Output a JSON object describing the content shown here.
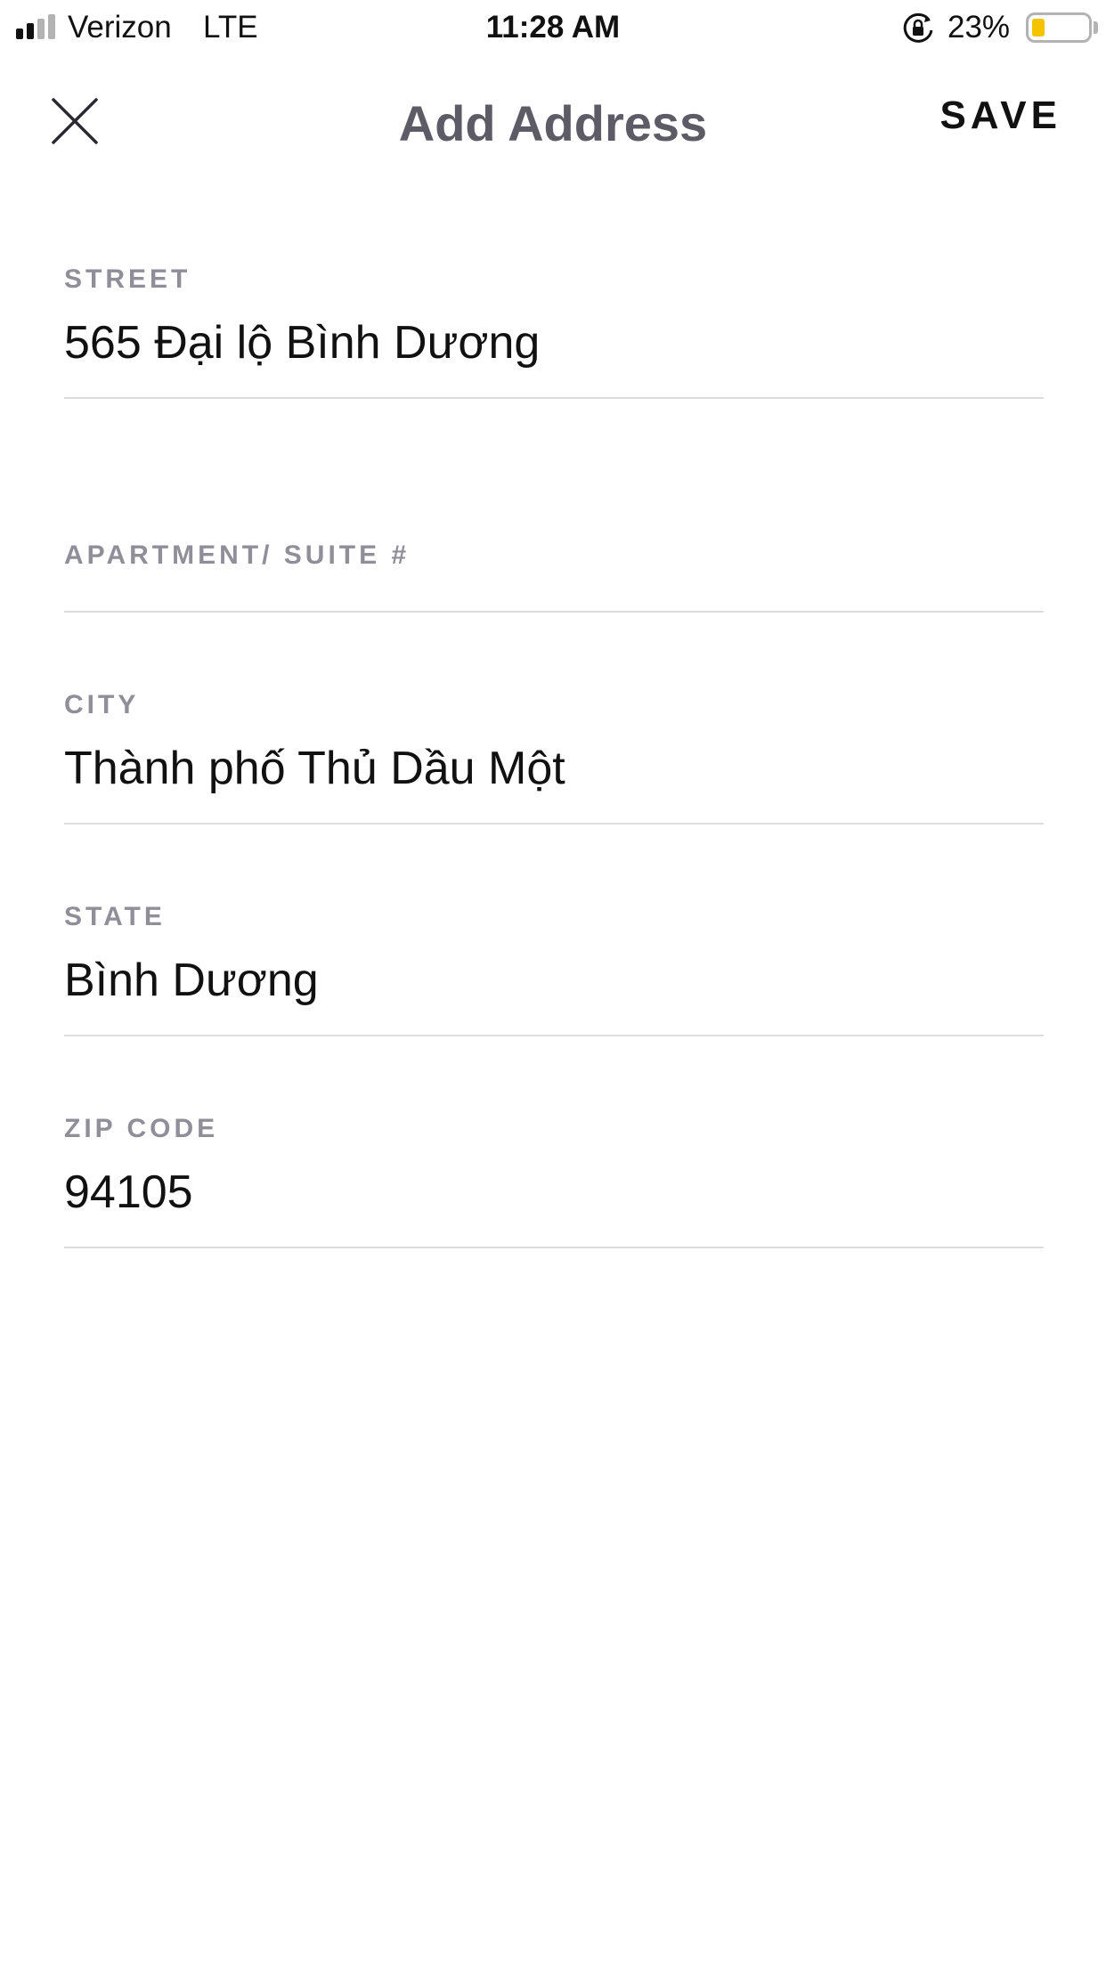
{
  "status_bar": {
    "carrier": "Verizon",
    "network": "LTE",
    "time": "11:28 AM",
    "battery_percent_text": "23%",
    "battery_level": 0.23,
    "battery_color": "#f5c400",
    "signal_bars_filled": 2,
    "signal_bars_total": 4,
    "rotation_lock_icon": "rotation-lock-icon"
  },
  "header": {
    "title": "Add Address",
    "close_icon": "close-icon",
    "save_label": "SAVE"
  },
  "form": {
    "fields": [
      {
        "label": "STREET",
        "value": "565 Đại lộ Bình Dương",
        "placeholder": ""
      },
      {
        "label": "APARTMENT/ SUITE #",
        "value": "",
        "placeholder": ""
      },
      {
        "label": "CITY",
        "value": "Thành phố Thủ Dầu Một",
        "placeholder": ""
      },
      {
        "label": "STATE",
        "value": "Bình Dương",
        "placeholder": ""
      },
      {
        "label": "ZIP CODE",
        "value": "94105",
        "placeholder": ""
      }
    ]
  },
  "colors": {
    "title": "#5d5c66",
    "label": "#8f8e99",
    "divider": "#dddde0",
    "text": "#111111"
  }
}
